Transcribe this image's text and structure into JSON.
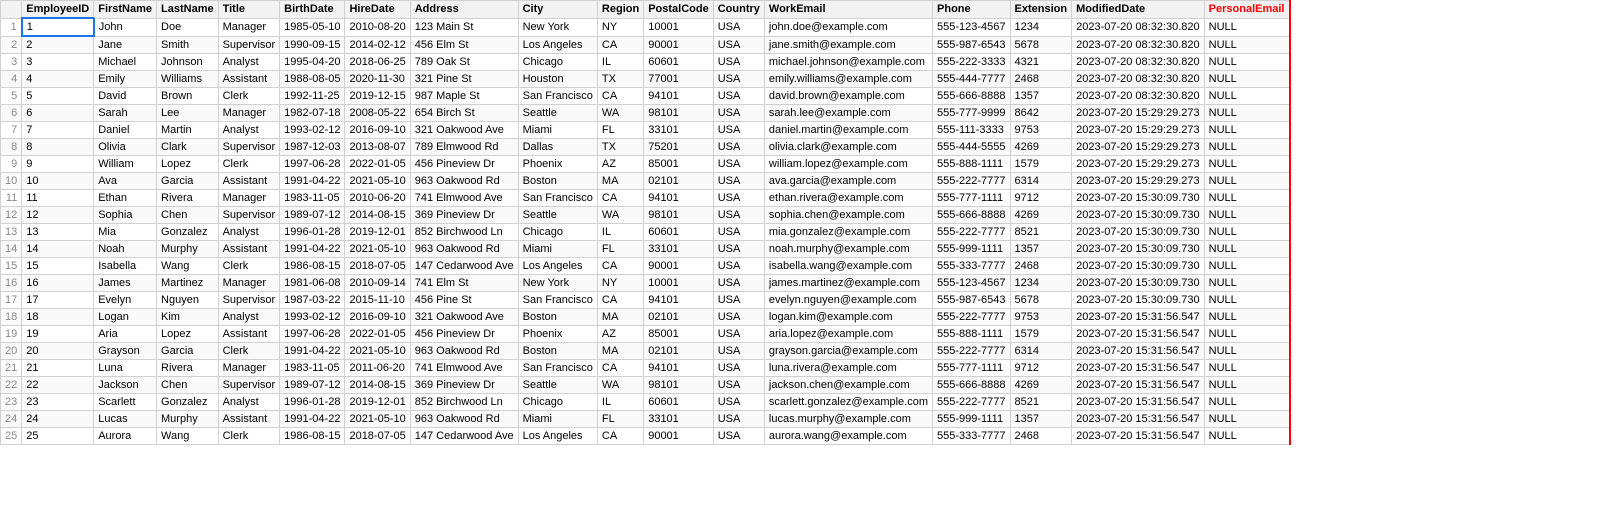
{
  "columns": [
    {
      "key": "rownum",
      "label": ""
    },
    {
      "key": "EmployeeID",
      "label": "EmployeeID"
    },
    {
      "key": "FirstName",
      "label": "FirstName"
    },
    {
      "key": "LastName",
      "label": "LastName"
    },
    {
      "key": "Title",
      "label": "Title"
    },
    {
      "key": "BirthDate",
      "label": "BirthDate"
    },
    {
      "key": "HireDate",
      "label": "HireDate"
    },
    {
      "key": "Address",
      "label": "Address"
    },
    {
      "key": "City",
      "label": "City"
    },
    {
      "key": "Region",
      "label": "Region"
    },
    {
      "key": "PostalCode",
      "label": "PostalCode"
    },
    {
      "key": "Country",
      "label": "Country"
    },
    {
      "key": "WorkEmail",
      "label": "WorkEmail"
    },
    {
      "key": "Phone",
      "label": "Phone"
    },
    {
      "key": "Extension",
      "label": "Extension"
    },
    {
      "key": "ModifiedDate",
      "label": "ModifiedDate"
    },
    {
      "key": "PersonalEmail",
      "label": "PersonalEmail"
    }
  ],
  "rows": [
    {
      "rownum": 1,
      "EmployeeID": 1,
      "FirstName": "John",
      "LastName": "Doe",
      "Title": "Manager",
      "BirthDate": "1985-05-10",
      "HireDate": "2010-08-20",
      "Address": "123 Main St",
      "City": "New York",
      "Region": "NY",
      "PostalCode": "10001",
      "Country": "USA",
      "WorkEmail": "john.doe@example.com",
      "Phone": "555-123-4567",
      "Extension": "1234",
      "ModifiedDate": "2023-07-20 08:32:30.820",
      "PersonalEmail": "NULL"
    },
    {
      "rownum": 2,
      "EmployeeID": 2,
      "FirstName": "Jane",
      "LastName": "Smith",
      "Title": "Supervisor",
      "BirthDate": "1990-09-15",
      "HireDate": "2014-02-12",
      "Address": "456 Elm St",
      "City": "Los Angeles",
      "Region": "CA",
      "PostalCode": "90001",
      "Country": "USA",
      "WorkEmail": "jane.smith@example.com",
      "Phone": "555-987-6543",
      "Extension": "5678",
      "ModifiedDate": "2023-07-20 08:32:30.820",
      "PersonalEmail": "NULL"
    },
    {
      "rownum": 3,
      "EmployeeID": 3,
      "FirstName": "Michael",
      "LastName": "Johnson",
      "Title": "Analyst",
      "BirthDate": "1995-04-20",
      "HireDate": "2018-06-25",
      "Address": "789 Oak St",
      "City": "Chicago",
      "Region": "IL",
      "PostalCode": "60601",
      "Country": "USA",
      "WorkEmail": "michael.johnson@example.com",
      "Phone": "555-222-3333",
      "Extension": "4321",
      "ModifiedDate": "2023-07-20 08:32:30.820",
      "PersonalEmail": "NULL"
    },
    {
      "rownum": 4,
      "EmployeeID": 4,
      "FirstName": "Emily",
      "LastName": "Williams",
      "Title": "Assistant",
      "BirthDate": "1988-08-05",
      "HireDate": "2020-11-30",
      "Address": "321 Pine St",
      "City": "Houston",
      "Region": "TX",
      "PostalCode": "77001",
      "Country": "USA",
      "WorkEmail": "emily.williams@example.com",
      "Phone": "555-444-7777",
      "Extension": "2468",
      "ModifiedDate": "2023-07-20 08:32:30.820",
      "PersonalEmail": "NULL"
    },
    {
      "rownum": 5,
      "EmployeeID": 5,
      "FirstName": "David",
      "LastName": "Brown",
      "Title": "Clerk",
      "BirthDate": "1992-11-25",
      "HireDate": "2019-12-15",
      "Address": "987 Maple St",
      "City": "San Francisco",
      "Region": "CA",
      "PostalCode": "94101",
      "Country": "USA",
      "WorkEmail": "david.brown@example.com",
      "Phone": "555-666-8888",
      "Extension": "1357",
      "ModifiedDate": "2023-07-20 08:32:30.820",
      "PersonalEmail": "NULL"
    },
    {
      "rownum": 6,
      "EmployeeID": 6,
      "FirstName": "Sarah",
      "LastName": "Lee",
      "Title": "Manager",
      "BirthDate": "1982-07-18",
      "HireDate": "2008-05-22",
      "Address": "654 Birch St",
      "City": "Seattle",
      "Region": "WA",
      "PostalCode": "98101",
      "Country": "USA",
      "WorkEmail": "sarah.lee@example.com",
      "Phone": "555-777-9999",
      "Extension": "8642",
      "ModifiedDate": "2023-07-20 15:29:29.273",
      "PersonalEmail": "NULL"
    },
    {
      "rownum": 7,
      "EmployeeID": 7,
      "FirstName": "Daniel",
      "LastName": "Martin",
      "Title": "Analyst",
      "BirthDate": "1993-02-12",
      "HireDate": "2016-09-10",
      "Address": "321 Oakwood Ave",
      "City": "Miami",
      "Region": "FL",
      "PostalCode": "33101",
      "Country": "USA",
      "WorkEmail": "daniel.martin@example.com",
      "Phone": "555-111-3333",
      "Extension": "9753",
      "ModifiedDate": "2023-07-20 15:29:29.273",
      "PersonalEmail": "NULL"
    },
    {
      "rownum": 8,
      "EmployeeID": 8,
      "FirstName": "Olivia",
      "LastName": "Clark",
      "Title": "Supervisor",
      "BirthDate": "1987-12-03",
      "HireDate": "2013-08-07",
      "Address": "789 Elmwood Rd",
      "City": "Dallas",
      "Region": "TX",
      "PostalCode": "75201",
      "Country": "USA",
      "WorkEmail": "olivia.clark@example.com",
      "Phone": "555-444-5555",
      "Extension": "4269",
      "ModifiedDate": "2023-07-20 15:29:29.273",
      "PersonalEmail": "NULL"
    },
    {
      "rownum": 9,
      "EmployeeID": 9,
      "FirstName": "William",
      "LastName": "Lopez",
      "Title": "Clerk",
      "BirthDate": "1997-06-28",
      "HireDate": "2022-01-05",
      "Address": "456 Pineview Dr",
      "City": "Phoenix",
      "Region": "AZ",
      "PostalCode": "85001",
      "Country": "USA",
      "WorkEmail": "william.lopez@example.com",
      "Phone": "555-888-1111",
      "Extension": "1579",
      "ModifiedDate": "2023-07-20 15:29:29.273",
      "PersonalEmail": "NULL"
    },
    {
      "rownum": 10,
      "EmployeeID": 10,
      "FirstName": "Ava",
      "LastName": "Garcia",
      "Title": "Assistant",
      "BirthDate": "1991-04-22",
      "HireDate": "2021-05-10",
      "Address": "963 Oakwood Rd",
      "City": "Boston",
      "Region": "MA",
      "PostalCode": "02101",
      "Country": "USA",
      "WorkEmail": "ava.garcia@example.com",
      "Phone": "555-222-7777",
      "Extension": "6314",
      "ModifiedDate": "2023-07-20 15:29:29.273",
      "PersonalEmail": "NULL"
    },
    {
      "rownum": 11,
      "EmployeeID": 11,
      "FirstName": "Ethan",
      "LastName": "Rivera",
      "Title": "Manager",
      "BirthDate": "1983-11-05",
      "HireDate": "2010-06-20",
      "Address": "741 Elmwood Ave",
      "City": "San Francisco",
      "Region": "CA",
      "PostalCode": "94101",
      "Country": "USA",
      "WorkEmail": "ethan.rivera@example.com",
      "Phone": "555-777-1111",
      "Extension": "9712",
      "ModifiedDate": "2023-07-20 15:30:09.730",
      "PersonalEmail": "NULL"
    },
    {
      "rownum": 12,
      "EmployeeID": 12,
      "FirstName": "Sophia",
      "LastName": "Chen",
      "Title": "Supervisor",
      "BirthDate": "1989-07-12",
      "HireDate": "2014-08-15",
      "Address": "369 Pineview Dr",
      "City": "Seattle",
      "Region": "WA",
      "PostalCode": "98101",
      "Country": "USA",
      "WorkEmail": "sophia.chen@example.com",
      "Phone": "555-666-8888",
      "Extension": "4269",
      "ModifiedDate": "2023-07-20 15:30:09.730",
      "PersonalEmail": "NULL"
    },
    {
      "rownum": 13,
      "EmployeeID": 13,
      "FirstName": "Mia",
      "LastName": "Gonzalez",
      "Title": "Analyst",
      "BirthDate": "1996-01-28",
      "HireDate": "2019-12-01",
      "Address": "852 Birchwood Ln",
      "City": "Chicago",
      "Region": "IL",
      "PostalCode": "60601",
      "Country": "USA",
      "WorkEmail": "mia.gonzalez@example.com",
      "Phone": "555-222-7777",
      "Extension": "8521",
      "ModifiedDate": "2023-07-20 15:30:09.730",
      "PersonalEmail": "NULL"
    },
    {
      "rownum": 14,
      "EmployeeID": 14,
      "FirstName": "Noah",
      "LastName": "Murphy",
      "Title": "Assistant",
      "BirthDate": "1991-04-22",
      "HireDate": "2021-05-10",
      "Address": "963 Oakwood Rd",
      "City": "Miami",
      "Region": "FL",
      "PostalCode": "33101",
      "Country": "USA",
      "WorkEmail": "noah.murphy@example.com",
      "Phone": "555-999-1111",
      "Extension": "1357",
      "ModifiedDate": "2023-07-20 15:30:09.730",
      "PersonalEmail": "NULL"
    },
    {
      "rownum": 15,
      "EmployeeID": 15,
      "FirstName": "Isabella",
      "LastName": "Wang",
      "Title": "Clerk",
      "BirthDate": "1986-08-15",
      "HireDate": "2018-07-05",
      "Address": "147 Cedarwood Ave",
      "City": "Los Angeles",
      "Region": "CA",
      "PostalCode": "90001",
      "Country": "USA",
      "WorkEmail": "isabella.wang@example.com",
      "Phone": "555-333-7777",
      "Extension": "2468",
      "ModifiedDate": "2023-07-20 15:30:09.730",
      "PersonalEmail": "NULL"
    },
    {
      "rownum": 16,
      "EmployeeID": 16,
      "FirstName": "James",
      "LastName": "Martinez",
      "Title": "Manager",
      "BirthDate": "1981-06-08",
      "HireDate": "2010-09-14",
      "Address": "741 Elm St",
      "City": "New York",
      "Region": "NY",
      "PostalCode": "10001",
      "Country": "USA",
      "WorkEmail": "james.martinez@example.com",
      "Phone": "555-123-4567",
      "Extension": "1234",
      "ModifiedDate": "2023-07-20 15:30:09.730",
      "PersonalEmail": "NULL"
    },
    {
      "rownum": 17,
      "EmployeeID": 17,
      "FirstName": "Evelyn",
      "LastName": "Nguyen",
      "Title": "Supervisor",
      "BirthDate": "1987-03-22",
      "HireDate": "2015-11-10",
      "Address": "456 Pine St",
      "City": "San Francisco",
      "Region": "CA",
      "PostalCode": "94101",
      "Country": "USA",
      "WorkEmail": "evelyn.nguyen@example.com",
      "Phone": "555-987-6543",
      "Extension": "5678",
      "ModifiedDate": "2023-07-20 15:30:09.730",
      "PersonalEmail": "NULL"
    },
    {
      "rownum": 18,
      "EmployeeID": 18,
      "FirstName": "Logan",
      "LastName": "Kim",
      "Title": "Analyst",
      "BirthDate": "1993-02-12",
      "HireDate": "2016-09-10",
      "Address": "321 Oakwood Ave",
      "City": "Boston",
      "Region": "MA",
      "PostalCode": "02101",
      "Country": "USA",
      "WorkEmail": "logan.kim@example.com",
      "Phone": "555-222-7777",
      "Extension": "9753",
      "ModifiedDate": "2023-07-20 15:31:56.547",
      "PersonalEmail": "NULL"
    },
    {
      "rownum": 19,
      "EmployeeID": 19,
      "FirstName": "Aria",
      "LastName": "Lopez",
      "Title": "Assistant",
      "BirthDate": "1997-06-28",
      "HireDate": "2022-01-05",
      "Address": "456 Pineview Dr",
      "City": "Phoenix",
      "Region": "AZ",
      "PostalCode": "85001",
      "Country": "USA",
      "WorkEmail": "aria.lopez@example.com",
      "Phone": "555-888-1111",
      "Extension": "1579",
      "ModifiedDate": "2023-07-20 15:31:56.547",
      "PersonalEmail": "NULL"
    },
    {
      "rownum": 20,
      "EmployeeID": 20,
      "FirstName": "Grayson",
      "LastName": "Garcia",
      "Title": "Clerk",
      "BirthDate": "1991-04-22",
      "HireDate": "2021-05-10",
      "Address": "963 Oakwood Rd",
      "City": "Boston",
      "Region": "MA",
      "PostalCode": "02101",
      "Country": "USA",
      "WorkEmail": "grayson.garcia@example.com",
      "Phone": "555-222-7777",
      "Extension": "6314",
      "ModifiedDate": "2023-07-20 15:31:56.547",
      "PersonalEmail": "NULL"
    },
    {
      "rownum": 21,
      "EmployeeID": 21,
      "FirstName": "Luna",
      "LastName": "Rivera",
      "Title": "Manager",
      "BirthDate": "1983-11-05",
      "HireDate": "2011-06-20",
      "Address": "741 Elmwood Ave",
      "City": "San Francisco",
      "Region": "CA",
      "PostalCode": "94101",
      "Country": "USA",
      "WorkEmail": "luna.rivera@example.com",
      "Phone": "555-777-1111",
      "Extension": "9712",
      "ModifiedDate": "2023-07-20 15:31:56.547",
      "PersonalEmail": "NULL"
    },
    {
      "rownum": 22,
      "EmployeeID": 22,
      "FirstName": "Jackson",
      "LastName": "Chen",
      "Title": "Supervisor",
      "BirthDate": "1989-07-12",
      "HireDate": "2014-08-15",
      "Address": "369 Pineview Dr",
      "City": "Seattle",
      "Region": "WA",
      "PostalCode": "98101",
      "Country": "USA",
      "WorkEmail": "jackson.chen@example.com",
      "Phone": "555-666-8888",
      "Extension": "4269",
      "ModifiedDate": "2023-07-20 15:31:56.547",
      "PersonalEmail": "NULL"
    },
    {
      "rownum": 23,
      "EmployeeID": 23,
      "FirstName": "Scarlett",
      "LastName": "Gonzalez",
      "Title": "Analyst",
      "BirthDate": "1996-01-28",
      "HireDate": "2019-12-01",
      "Address": "852 Birchwood Ln",
      "City": "Chicago",
      "Region": "IL",
      "PostalCode": "60601",
      "Country": "USA",
      "WorkEmail": "scarlett.gonzalez@example.com",
      "Phone": "555-222-7777",
      "Extension": "8521",
      "ModifiedDate": "2023-07-20 15:31:56.547",
      "PersonalEmail": "NULL"
    },
    {
      "rownum": 24,
      "EmployeeID": 24,
      "FirstName": "Lucas",
      "LastName": "Murphy",
      "Title": "Assistant",
      "BirthDate": "1991-04-22",
      "HireDate": "2021-05-10",
      "Address": "963 Oakwood Rd",
      "City": "Miami",
      "Region": "FL",
      "PostalCode": "33101",
      "Country": "USA",
      "WorkEmail": "lucas.murphy@example.com",
      "Phone": "555-999-1111",
      "Extension": "1357",
      "ModifiedDate": "2023-07-20 15:31:56.547",
      "PersonalEmail": "NULL"
    },
    {
      "rownum": 25,
      "EmployeeID": 25,
      "FirstName": "Aurora",
      "LastName": "Wang",
      "Title": "Clerk",
      "BirthDate": "1986-08-15",
      "HireDate": "2018-07-05",
      "Address": "147 Cedarwood Ave",
      "City": "Los Angeles",
      "Region": "CA",
      "PostalCode": "90001",
      "Country": "USA",
      "WorkEmail": "aurora.wang@example.com",
      "Phone": "555-333-7777",
      "Extension": "2468",
      "ModifiedDate": "2023-07-20 15:31:56.547",
      "PersonalEmail": "NULL"
    }
  ]
}
